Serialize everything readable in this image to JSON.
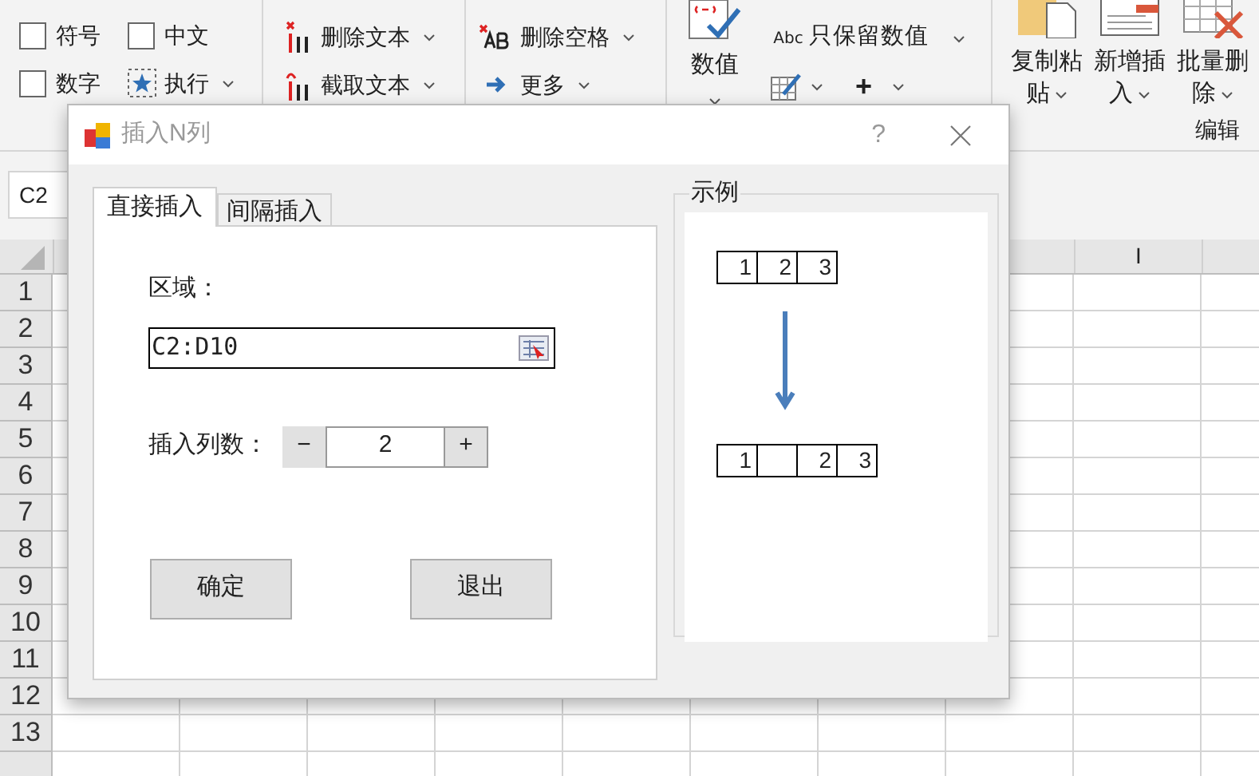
{
  "ribbon": {
    "checkboxes": [
      {
        "label": "符号",
        "checked": false
      },
      {
        "label": "中文",
        "checked": false
      },
      {
        "label": "数字",
        "checked": false
      }
    ],
    "execute": "执行",
    "text_tools": [
      "删除文本",
      "截取文本"
    ],
    "space_tools": [
      "删除空格",
      "更多"
    ],
    "value_button": "数值",
    "keep_values_icon": "Abc",
    "keep_values": "只保留数值",
    "plus": "+",
    "big_buttons": [
      {
        "line1": "复制粘",
        "line2": "贴"
      },
      {
        "line1": "新增插",
        "line2": "入"
      },
      {
        "line1": "批量删",
        "line2": "除"
      }
    ],
    "group_label": "编辑"
  },
  "name_box": "C2",
  "sheet": {
    "columns": [
      "I"
    ],
    "rows": [
      "1",
      "2",
      "3",
      "4",
      "5",
      "6",
      "7",
      "8",
      "9",
      "10",
      "11",
      "12",
      "13"
    ]
  },
  "dialog": {
    "title": "插入N列",
    "help": "?",
    "tabs": [
      {
        "label": "直接插入",
        "selected": true
      },
      {
        "label": "间隔插入",
        "selected": false
      }
    ],
    "range_label": "区域：",
    "range_value": "C2:D10",
    "count_label": "插入列数：",
    "count": {
      "minus": "−",
      "value": "2",
      "plus": "+"
    },
    "buttons": [
      "确定",
      "退出"
    ],
    "example": {
      "title": "示例",
      "before": [
        {
          "kind": "value",
          "text": "1"
        },
        {
          "kind": "value",
          "text": "2"
        },
        {
          "kind": "value",
          "text": "3"
        }
      ],
      "after": [
        {
          "kind": "value",
          "text": "1"
        },
        {
          "kind": "blank"
        },
        {
          "kind": "value",
          "text": "2"
        },
        {
          "kind": "value",
          "text": "3"
        }
      ]
    }
  }
}
